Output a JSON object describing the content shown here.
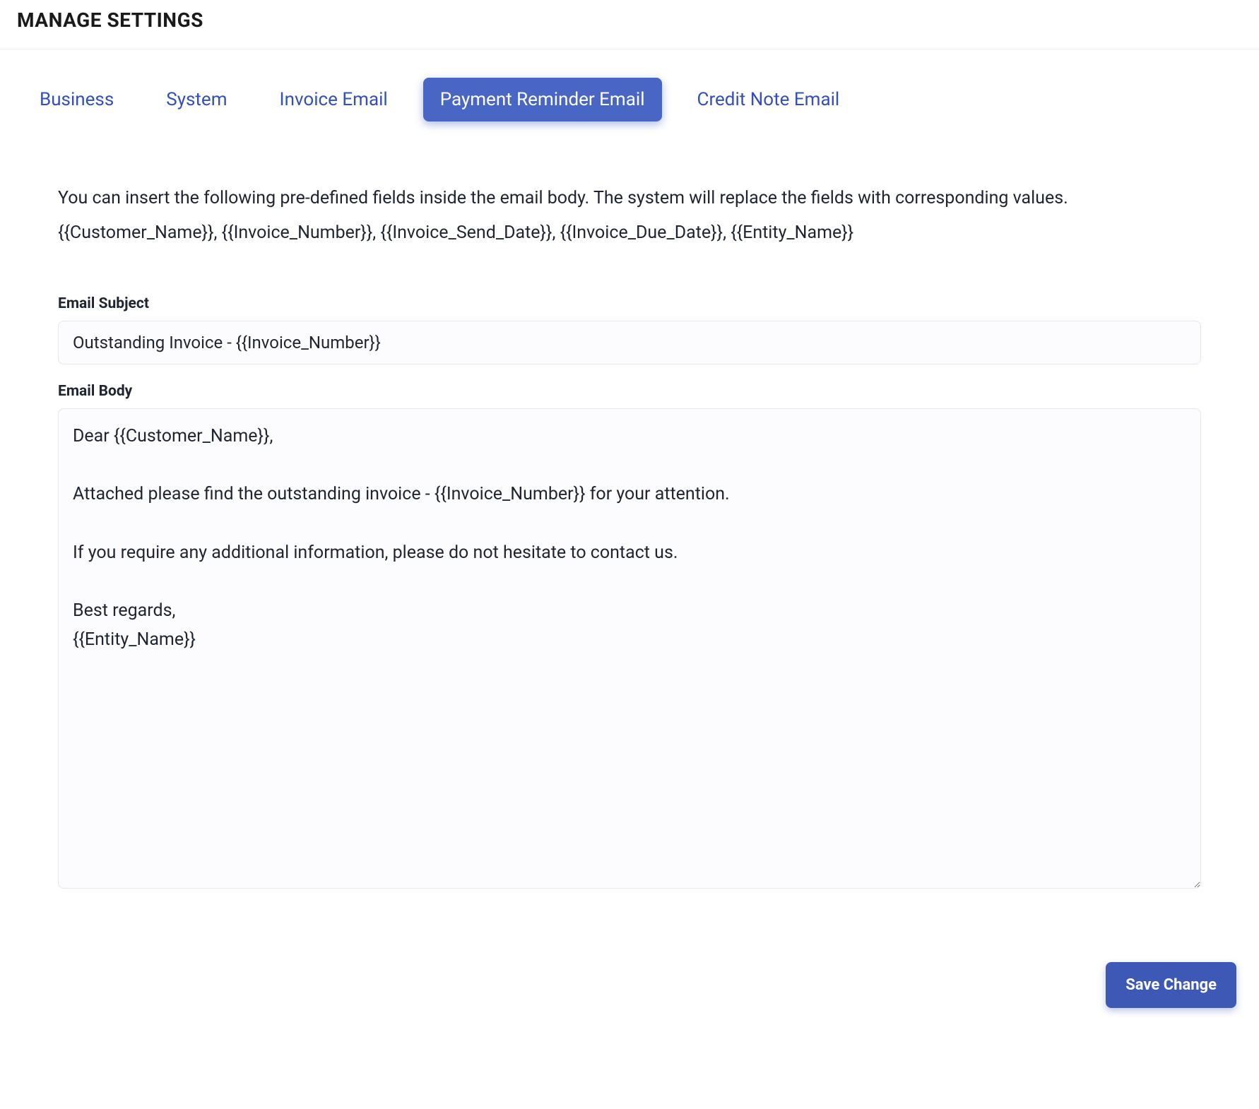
{
  "header": {
    "title": "MANAGE SETTINGS"
  },
  "tabs": [
    {
      "label": "Business",
      "active": false
    },
    {
      "label": "System",
      "active": false
    },
    {
      "label": "Invoice Email",
      "active": false
    },
    {
      "label": "Payment Reminder Email",
      "active": true
    },
    {
      "label": "Credit Note Email",
      "active": false
    }
  ],
  "info": {
    "line1": "You can insert the following pre-defined fields inside the email body. The system will replace the fields with corresponding values.",
    "line2": "{{Customer_Name}}, {{Invoice_Number}}, {{Invoice_Send_Date}}, {{Invoice_Due_Date}}, {{Entity_Name}}"
  },
  "form": {
    "subject_label": "Email Subject",
    "subject_value": "Outstanding Invoice - {{Invoice_Number}}",
    "body_label": "Email Body",
    "body_value": "Dear {{Customer_Name}},\n\nAttached please find the outstanding invoice - {{Invoice_Number}} for your attention.\n\nIf you require any additional information, please do not hesitate to contact us.\n\nBest regards,\n{{Entity_Name}}"
  },
  "actions": {
    "save_label": "Save Change"
  }
}
